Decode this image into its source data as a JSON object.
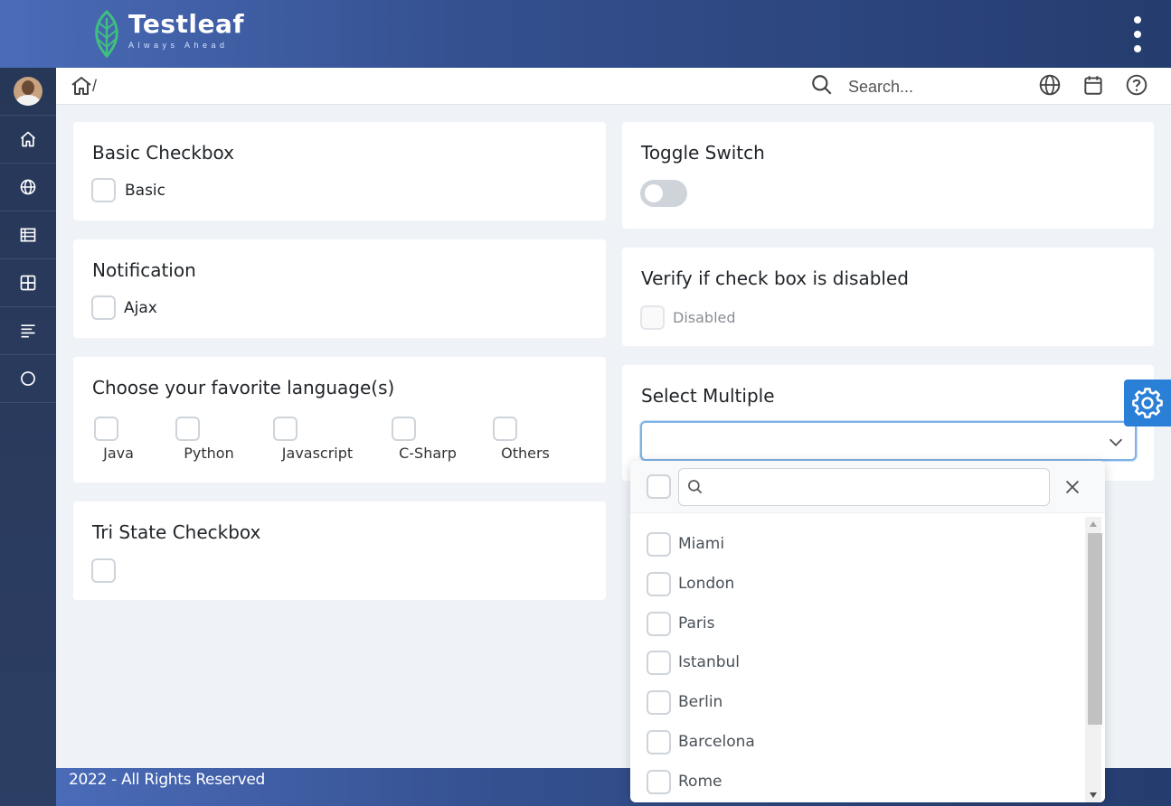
{
  "header": {
    "brand": "Testleaf",
    "tagline": "Always Ahead"
  },
  "sidebar": {
    "items": [
      {
        "icon": "avatar"
      },
      {
        "icon": "home-icon"
      },
      {
        "icon": "globe-icon"
      },
      {
        "icon": "table-icon"
      },
      {
        "icon": "grid-icon"
      },
      {
        "icon": "text-align-icon"
      },
      {
        "icon": "circle-icon"
      }
    ]
  },
  "breadcrumb": {
    "separator": "/"
  },
  "search": {
    "placeholder": "Search...",
    "value": ""
  },
  "cards": {
    "basic": {
      "title": "Basic Checkbox",
      "label": "Basic"
    },
    "notification": {
      "title": "Notification",
      "label": "Ajax"
    },
    "languages": {
      "title": "Choose your favorite language(s)",
      "options": [
        "Java",
        "Python",
        "Javascript",
        "C-Sharp",
        "Others"
      ]
    },
    "tristate": {
      "title": "Tri State Checkbox"
    },
    "toggle": {
      "title": "Toggle Switch",
      "on": false
    },
    "disabled": {
      "title": "Verify if check box is disabled",
      "label": "Disabled"
    },
    "multiple": {
      "title": "Select Multiple",
      "value": ""
    }
  },
  "dropdown": {
    "filter_value": "",
    "options": [
      "Miami",
      "London",
      "Paris",
      "Istanbul",
      "Berlin",
      "Barcelona",
      "Rome"
    ]
  },
  "footer": {
    "text": "2022 - All Rights Reserved"
  },
  "colors": {
    "accent": "#2a7fd6",
    "header_start": "#4a6bb8",
    "header_end": "#253c6e",
    "sidebar": "#273758"
  }
}
